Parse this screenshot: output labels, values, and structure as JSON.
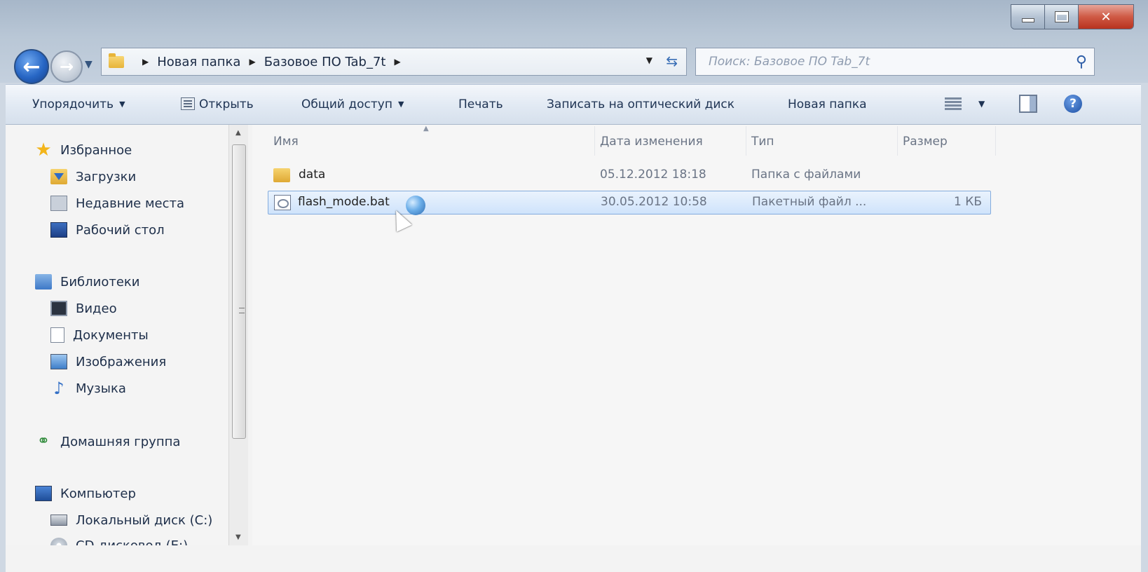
{
  "nav": {
    "path": [
      "Новая папка",
      "Базовое ПО Tab_7t"
    ],
    "search_placeholder": "Поиск: Базовое ПО Tab_7t"
  },
  "toolbar": {
    "organize": "Упорядочить",
    "open": "Открыть",
    "share": "Общий доступ",
    "print": "Печать",
    "burn": "Записать на оптический диск",
    "new_folder": "Новая папка"
  },
  "sidebar": {
    "favorites": "Избранное",
    "downloads": "Загрузки",
    "recent": "Недавние места",
    "desktop": "Рабочий стол",
    "libraries": "Библиотеки",
    "video": "Видео",
    "documents": "Документы",
    "images": "Изображения",
    "music": "Музыка",
    "homegroup": "Домашняя группа",
    "computer": "Компьютер",
    "local_disk": "Локальный диск (C:)",
    "cd_drive": "CD-дисковод (E:)"
  },
  "columns": {
    "name": "Имя",
    "date": "Дата изменения",
    "type": "Тип",
    "size": "Размер"
  },
  "files": [
    {
      "name": "data",
      "date": "05.12.2012 18:18",
      "type": "Папка с файлами",
      "size": ""
    },
    {
      "name": "flash_mode.bat",
      "date": "30.05.2012 10:58",
      "type": "Пакетный файл ...",
      "size": "1 КБ"
    }
  ],
  "icons": {
    "back": "back-arrow-icon",
    "forward": "forward-arrow-icon",
    "search": "search-icon",
    "help": "help-icon"
  },
  "colors": {
    "selection": "#cfe3fb",
    "selection_border": "#84acdd",
    "accent": "#2766c4"
  }
}
